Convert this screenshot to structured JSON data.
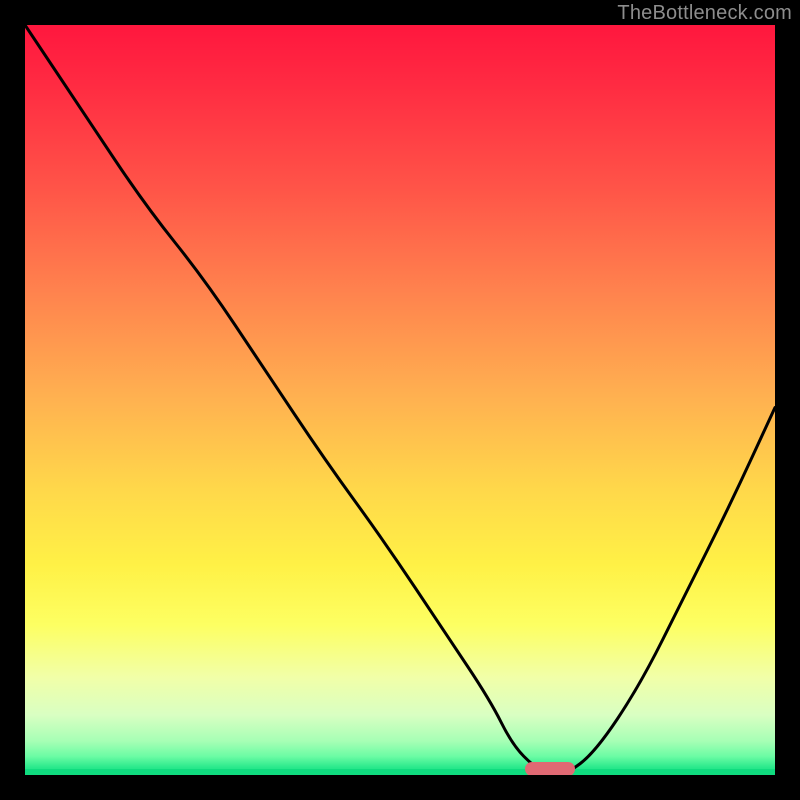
{
  "watermark": "TheBottleneck.com",
  "chart_data": {
    "type": "line",
    "title": "",
    "xlabel": "",
    "ylabel": "",
    "xlim": [
      0,
      100
    ],
    "ylim": [
      0,
      100
    ],
    "grid": false,
    "series": [
      {
        "name": "bottleneck-curve",
        "x": [
          0,
          8,
          16,
          24,
          32,
          40,
          48,
          56,
          62,
          65,
          68,
          70,
          72,
          76,
          82,
          88,
          94,
          100
        ],
        "y": [
          100,
          88,
          76,
          66,
          54,
          42,
          31,
          19,
          10,
          4,
          1,
          0,
          0,
          3,
          12,
          24,
          36,
          49
        ]
      }
    ],
    "marker": {
      "x": 70,
      "y": 0.8
    },
    "gradient_stops": [
      {
        "pos": 0.0,
        "color": "#ff173e"
      },
      {
        "pos": 0.5,
        "color": "#ffb250"
      },
      {
        "pos": 0.8,
        "color": "#fdff62"
      },
      {
        "pos": 1.0,
        "color": "#10dc7f"
      }
    ]
  }
}
